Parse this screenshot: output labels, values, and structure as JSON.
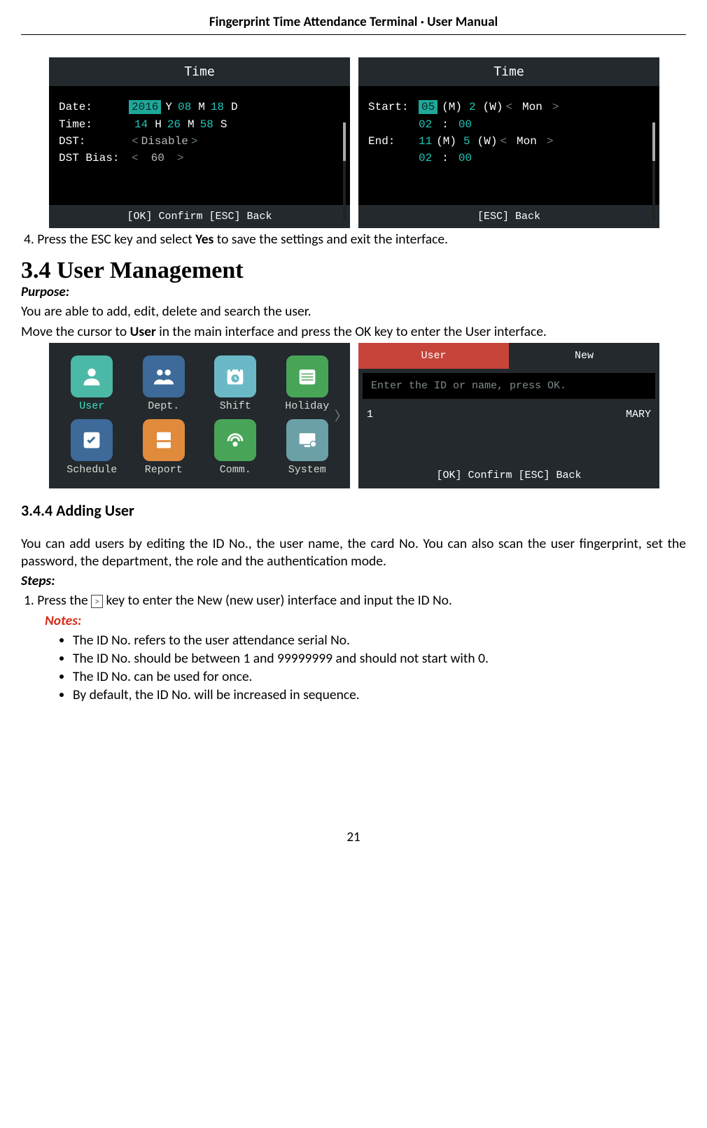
{
  "header": "Fingerprint Time Attendance Terminal · User Manual",
  "screen1": {
    "title": "Time",
    "rows": {
      "date_label": "Date:",
      "date_y": "2016",
      "y_suf": "Y",
      "date_m": "08",
      "m_suf": "M",
      "date_d": "18",
      "d_suf": "D",
      "time_label": "Time:",
      "time_h": "14",
      "h_suf": "H",
      "time_mi": "26",
      "mi_suf": "M",
      "time_s": "58",
      "s_suf": "S",
      "dst_label": "DST:",
      "dst_val": "Disable",
      "bias_label": "DST Bias:",
      "bias_val": "60"
    },
    "foot": "[OK] Confirm   [ESC] Back"
  },
  "screen2": {
    "title": "Time",
    "start_label": "Start:",
    "start_m": "05",
    "m_tag": "(M)",
    "start_w": "2",
    "w_tag": "(W)",
    "start_day": "Mon",
    "start_hh": "02",
    "colon": ":",
    "start_mm": "00",
    "end_label": "End:",
    "end_m": "11",
    "end_w": "5",
    "end_day": "Mon",
    "end_hh": "02",
    "end_mm": "00",
    "foot": "[ESC] Back"
  },
  "step4_pre": "4.   Press the ESC key and select ",
  "step4_yes": "Yes",
  "step4_post": " to save the settings and exit the interface.",
  "h2": "3.4 User Management",
  "purpose_label": "Purpose:",
  "purpose_text": "You are able to add, edit, delete and search the user.",
  "cursor_pre": "Move the cursor to ",
  "cursor_user": "User",
  "cursor_post": " in the main interface and press the OK key to enter the User interface.",
  "menu": {
    "items": [
      {
        "label": "User"
      },
      {
        "label": "Dept."
      },
      {
        "label": "Shift"
      },
      {
        "label": "Holiday"
      },
      {
        "label": "Schedule"
      },
      {
        "label": "Report"
      },
      {
        "label": "Comm."
      },
      {
        "label": "System"
      }
    ]
  },
  "userScreen": {
    "tab1": "User",
    "tab2": "New",
    "hint": "Enter the ID or name, press OK.",
    "row_id": "1",
    "row_name": "MARY",
    "foot": "[OK] Confirm   [ESC] Back"
  },
  "h3": "3.4.4   Adding User",
  "para": "You can add users by editing the ID No., the user name, the card No. You can also scan the user fingerprint, set the password, the department, the role and the authentication mode.",
  "steps_label": "Steps:",
  "step1_pre": "1.   Press the ",
  "step1_post": " key to enter the New (new user) interface and input the ID No.",
  "key_icon": ">",
  "notes_label": "Notes:",
  "notes": [
    "The ID No. refers to the user attendance serial No.",
    "The ID No. should be between 1 and 99999999 and should not start with 0.",
    "The ID No. can be used for once.",
    "By default, the ID No. will be increased in sequence."
  ],
  "page_num": "21"
}
